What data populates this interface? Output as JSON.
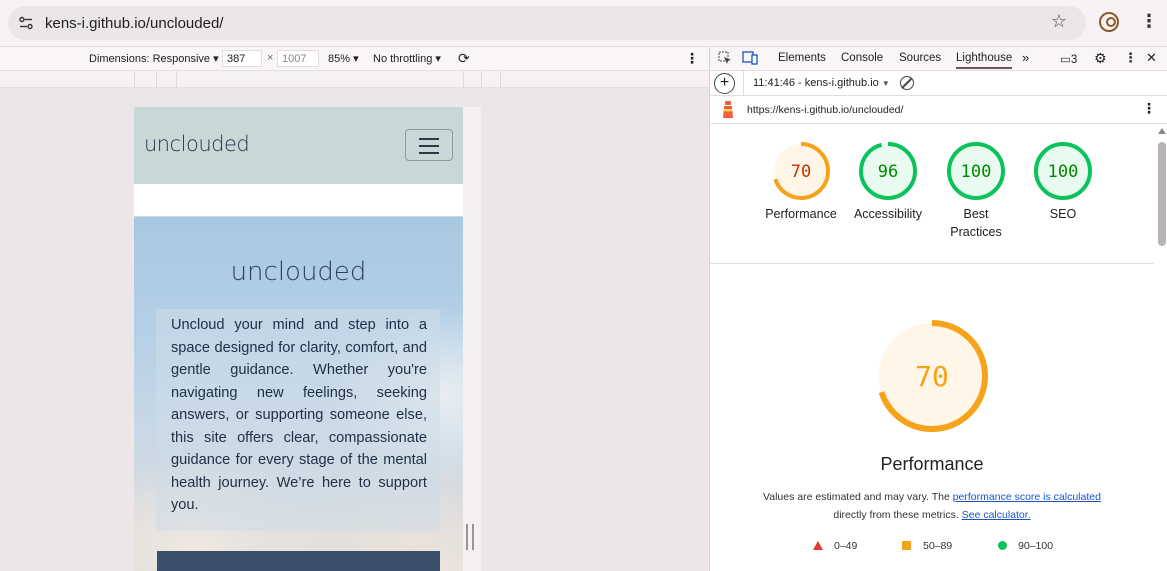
{
  "browser": {
    "url": "kens-i.github.io/unclouded/"
  },
  "device_toolbar": {
    "dimensions_label": "Dimensions: Responsive",
    "width": "387",
    "times": "×",
    "height": "1007",
    "zoom": "85%",
    "throttling": "No throttling"
  },
  "site": {
    "logo": "unclouded",
    "hero_title": "unclouded",
    "hero_text": "Uncloud your mind and step into a space designed for clarity, comfort, and gentle guidance. Whether you're navigating new feelings, seeking answers, or supporting someone else, this site offers clear, compassionate guidance for every stage of the mental health journey. We’re here to support you."
  },
  "devtools": {
    "tabs": [
      "Elements",
      "Console",
      "Sources",
      "Lighthouse"
    ],
    "issues_count": "3",
    "report_time": "11:41:46 - kens-i.github.io",
    "report_url": "https://kens-i.github.io/unclouded/"
  },
  "lighthouse": {
    "scores": [
      {
        "label": "Performance",
        "value": 70,
        "color": "#f4a31a"
      },
      {
        "label": "Accessibility",
        "value": 96,
        "color": "#0cc25a"
      },
      {
        "label": "Best Practices",
        "value": 100,
        "color": "#0cc25a"
      },
      {
        "label": "SEO",
        "value": 100,
        "color": "#0cc25a"
      }
    ],
    "main": {
      "label": "Performance",
      "value": 70,
      "color": "#f4a31a"
    },
    "note_prefix": "Values are estimated and may vary. The",
    "note_link": "performance score is calculated",
    "note_mid": "directly from these metrics.",
    "note_link2": "See calculator.",
    "legend": [
      "0–49",
      "50–89",
      "90–100"
    ]
  }
}
